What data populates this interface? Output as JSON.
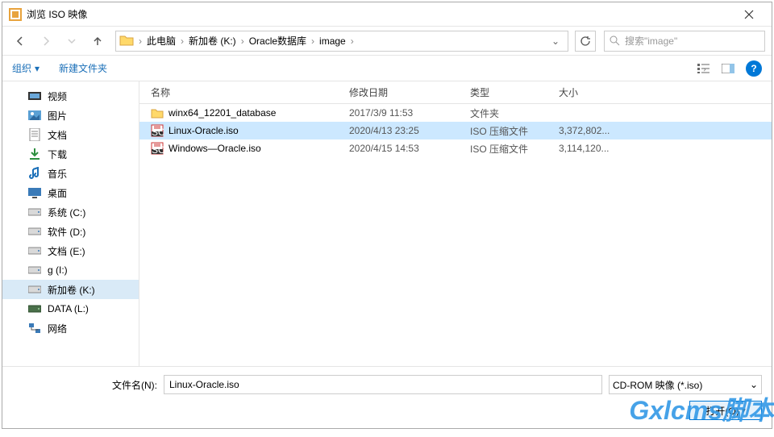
{
  "title": "浏览 ISO 映像",
  "breadcrumbs": [
    "此电脑",
    "新加卷 (K:)",
    "Oracle数据库",
    "image"
  ],
  "search_placeholder": "搜索\"image\"",
  "toolbar": {
    "organize": "组织",
    "new_folder": "新建文件夹"
  },
  "sidebar": {
    "items": [
      {
        "label": "视频",
        "icon": "video"
      },
      {
        "label": "图片",
        "icon": "pictures"
      },
      {
        "label": "文档",
        "icon": "documents"
      },
      {
        "label": "下载",
        "icon": "downloads"
      },
      {
        "label": "音乐",
        "icon": "music"
      },
      {
        "label": "桌面",
        "icon": "desktop"
      },
      {
        "label": "系统 (C:)",
        "icon": "drive"
      },
      {
        "label": "软件 (D:)",
        "icon": "drive"
      },
      {
        "label": "文档 (E:)",
        "icon": "drive"
      },
      {
        "label": "g (I:)",
        "icon": "drive"
      },
      {
        "label": "新加卷 (K:)",
        "icon": "drive",
        "selected": true
      },
      {
        "label": "DATA (L:)",
        "icon": "drive-alt"
      },
      {
        "label": "网络",
        "icon": "network"
      }
    ]
  },
  "columns": {
    "name": "名称",
    "date": "修改日期",
    "type": "类型",
    "size": "大小"
  },
  "rows": [
    {
      "name": "winx64_12201_database",
      "date": "2017/3/9 11:53",
      "type": "文件夹",
      "size": "",
      "icon": "folder"
    },
    {
      "name": "Linux-Oracle.iso",
      "date": "2020/4/13 23:25",
      "type": "ISO 压缩文件",
      "size": "3,372,802...",
      "icon": "iso",
      "selected": true
    },
    {
      "name": "Windows—Oracle.iso",
      "date": "2020/4/15 14:53",
      "type": "ISO 压缩文件",
      "size": "3,114,120...",
      "icon": "iso"
    }
  ],
  "bottom": {
    "filename_label": "文件名(N):",
    "filename_value": "Linux-Oracle.iso",
    "filter": "CD-ROM 映像 (*.iso)",
    "open": "打开(O)"
  },
  "watermark": "Gxlcms脚本"
}
